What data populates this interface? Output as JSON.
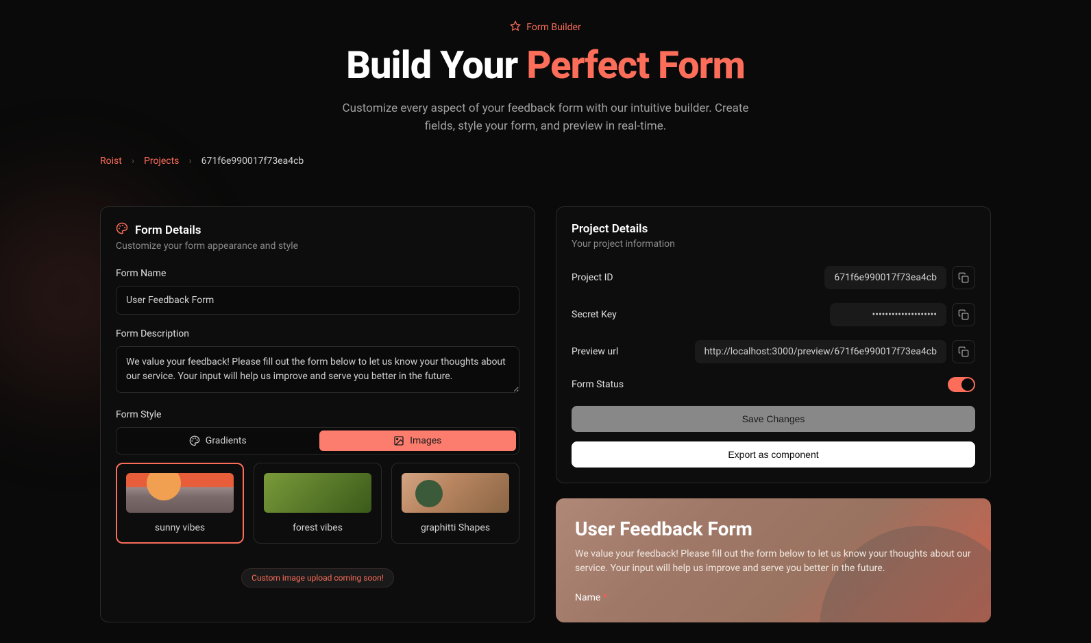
{
  "header": {
    "badge": "Form Builder",
    "title_prefix": "Build Your ",
    "title_accent": "Perfect Form",
    "subtitle": "Customize every aspect of your feedback form with our intuitive builder. Create fields, style your form, and preview in real-time."
  },
  "breadcrumb": {
    "items": [
      "Roist",
      "Projects"
    ],
    "current": "671f6e990017f73ea4cb"
  },
  "form_details": {
    "title": "Form Details",
    "subtitle": "Customize your form appearance and style",
    "name_label": "Form Name",
    "name_value": "User Feedback Form",
    "desc_label": "Form Description",
    "desc_value": "We value your feedback! Please fill out the form below to let us know your thoughts about our service. Your input will help us improve and serve you better in the future.",
    "style_label": "Form Style",
    "tabs": {
      "gradients": "Gradients",
      "images": "Images"
    },
    "styles": [
      {
        "label": "sunny vibes",
        "selected": true
      },
      {
        "label": "forest vibes",
        "selected": false
      },
      {
        "label": "graphitti Shapes",
        "selected": false
      }
    ],
    "upload_note": "Custom image upload coming soon!"
  },
  "project_details": {
    "title": "Project Details",
    "subtitle": "Your project information",
    "id_label": "Project ID",
    "id_value": "671f6e990017f73ea4cb",
    "secret_label": "Secret Key",
    "secret_value": "••••••••••••••••••••",
    "preview_label": "Preview url",
    "preview_value": "http://localhost:3000/preview/671f6e990017f73ea4cb",
    "status_label": "Form Status",
    "save_label": "Save Changes",
    "export_label": "Export as component"
  },
  "preview": {
    "title": "User Feedback Form",
    "desc": "We value your feedback! Please fill out the form below to let us know your thoughts about our service. Your input will help us improve and serve you better in the future.",
    "field_label": "Name",
    "required": "*"
  }
}
